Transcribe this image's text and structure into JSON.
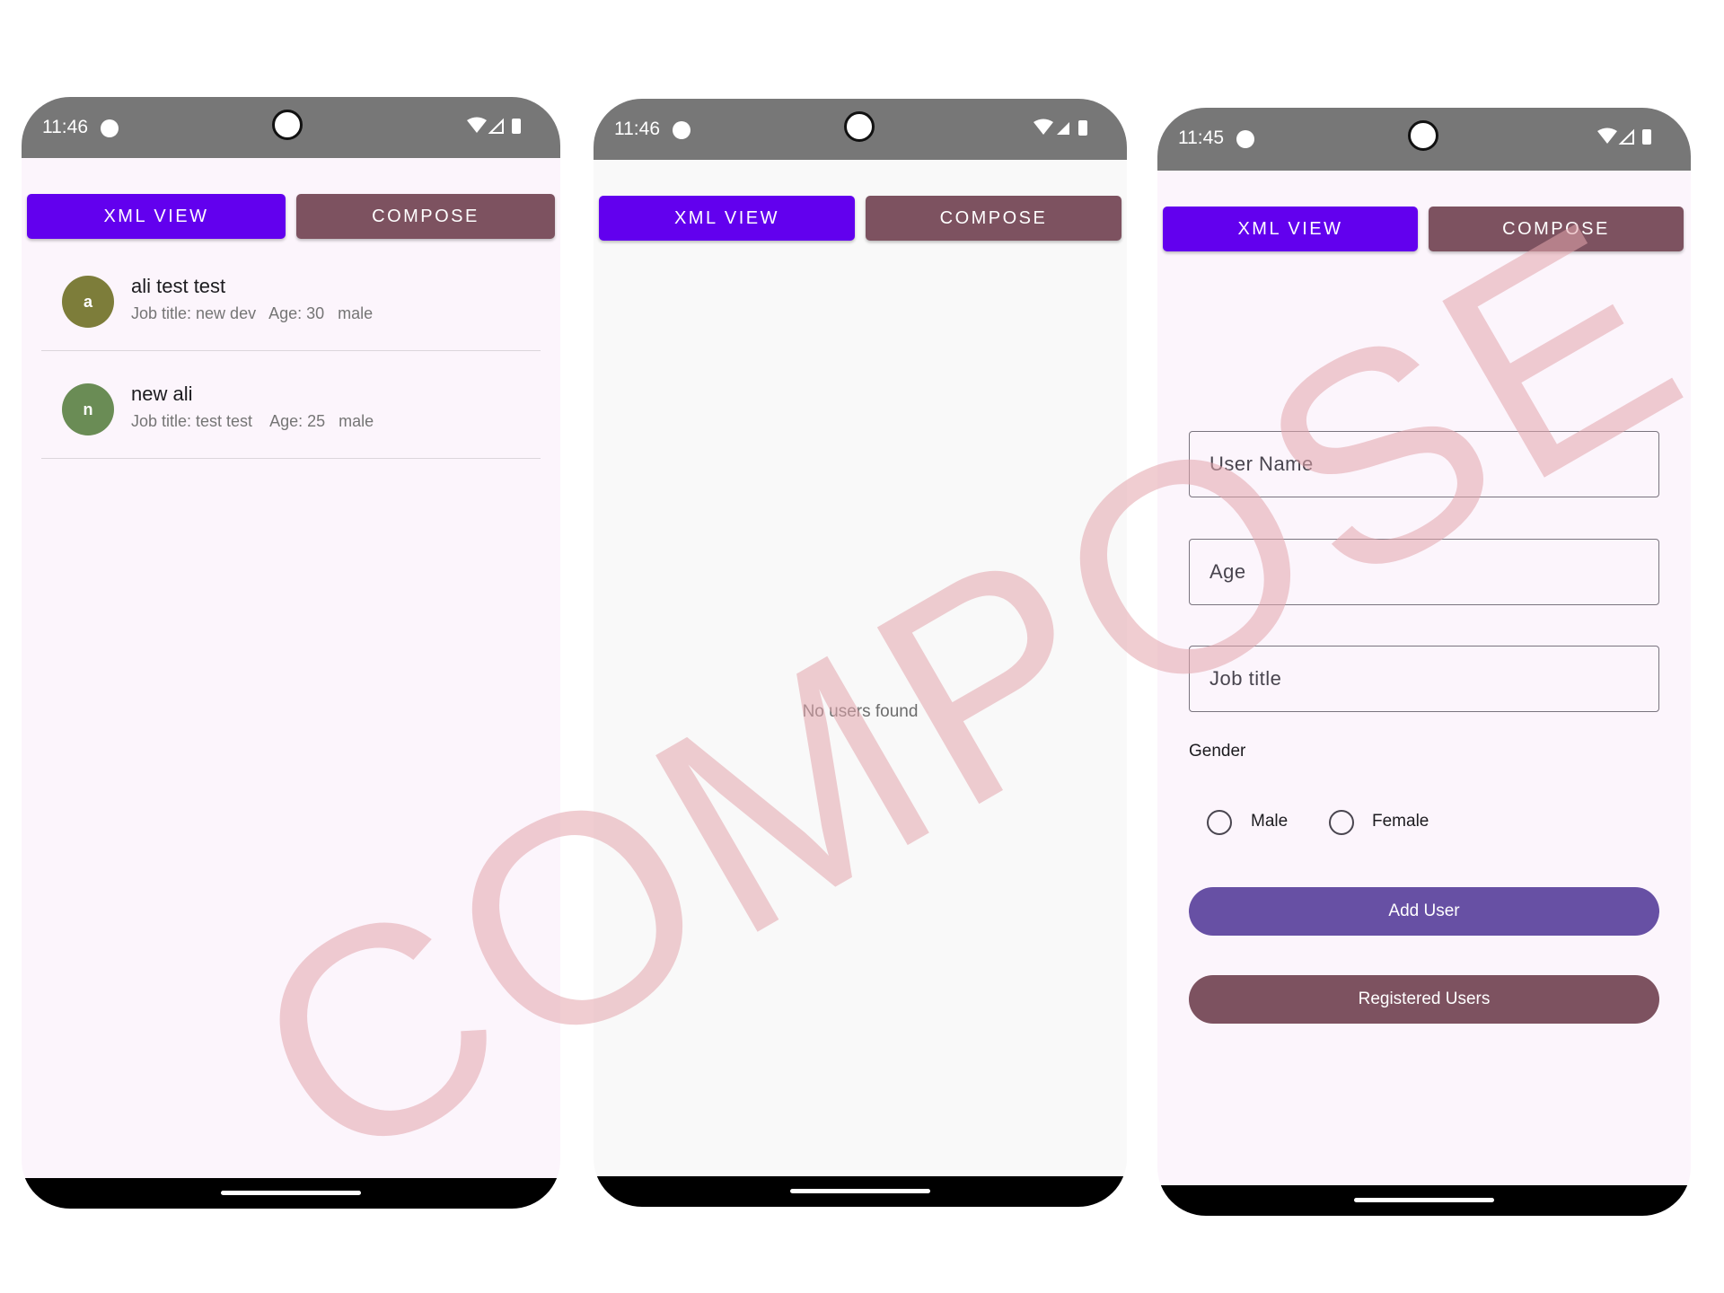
{
  "watermark": "COMPOSE",
  "colors": {
    "xml_button": "#6200ee",
    "compose_button": "#7d5260",
    "add_user_button": "#6750a4",
    "registered_users_button": "#7d5260",
    "status_bar": "#777777",
    "avatar_a": "#7d7d3a",
    "avatar_n": "#6a8c55"
  },
  "phones": [
    {
      "status": {
        "time": "11:46"
      },
      "tabs": {
        "xml": "XML VIEW",
        "compose": "COMPOSE"
      },
      "users": [
        {
          "avatar": "a",
          "name": "ali test test",
          "details": "Job title: new dev   Age: 30   male"
        },
        {
          "avatar": "n",
          "name": "new ali",
          "details": "Job title: test test    Age: 25   male"
        }
      ]
    },
    {
      "status": {
        "time": "11:46"
      },
      "tabs": {
        "xml": "XML VIEW",
        "compose": "COMPOSE"
      },
      "empty_message": "No users found"
    },
    {
      "status": {
        "time": "11:45"
      },
      "tabs": {
        "xml": "XML VIEW",
        "compose": "COMPOSE"
      },
      "form": {
        "username_label": "User Name",
        "age_label": "Age",
        "job_label": "Job title",
        "gender_label": "Gender",
        "gender_options": [
          "Male",
          "Female"
        ],
        "gender_selected": "none",
        "add_button": "Add User",
        "registered_button": "Registered Users"
      }
    }
  ]
}
